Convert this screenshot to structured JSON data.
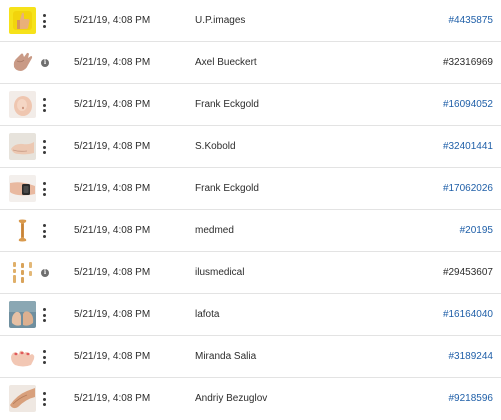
{
  "rows": [
    {
      "thumb": "thumbs-up-icon",
      "action": "more-options",
      "date": "5/21/19, 4:08 PM",
      "author": "U.P.images",
      "id": "#4435875",
      "id_link": true
    },
    {
      "thumb": "hand-wave-icon",
      "action": "info",
      "date": "5/21/19, 4:08 PM",
      "author": "Axel Bueckert",
      "id": "#32316969",
      "id_link": false
    },
    {
      "thumb": "belly-photo",
      "action": "more-options",
      "date": "5/21/19, 4:08 PM",
      "author": "Frank Eckgold",
      "id": "#16094052",
      "id_link": true
    },
    {
      "thumb": "foot-photo",
      "action": "more-options",
      "date": "5/21/19, 4:08 PM",
      "author": "S.Kobold",
      "id": "#32401441",
      "id_link": true
    },
    {
      "thumb": "wrist-photo",
      "action": "more-options",
      "date": "5/21/19, 4:08 PM",
      "author": "Frank Eckgold",
      "id": "#17062026",
      "id_link": true
    },
    {
      "thumb": "bone-icon",
      "action": "more-options",
      "date": "5/21/19, 4:08 PM",
      "author": "medmed",
      "id": "#20195",
      "id_link": true
    },
    {
      "thumb": "bones-icon",
      "action": "info",
      "date": "5/21/19, 4:08 PM",
      "author": "ilusmedical",
      "id": "#29453607",
      "id_link": false
    },
    {
      "thumb": "feet-photo",
      "action": "more-options",
      "date": "5/21/19, 4:08 PM",
      "author": "lafota",
      "id": "#16164040",
      "id_link": true
    },
    {
      "thumb": "fingers-photo",
      "action": "more-options",
      "date": "5/21/19, 4:08 PM",
      "author": "Miranda Salia",
      "id": "#3189244",
      "id_link": true
    },
    {
      "thumb": "arm-photo",
      "action": "more-options",
      "date": "5/21/19, 4:08 PM",
      "author": "Andriy Bezuglov",
      "id": "#9218596",
      "id_link": true
    }
  ],
  "info_glyph": "i",
  "colors": {
    "link": "#1f5fa8",
    "text": "#2c2c2c",
    "divider": "#e3e3e3"
  }
}
